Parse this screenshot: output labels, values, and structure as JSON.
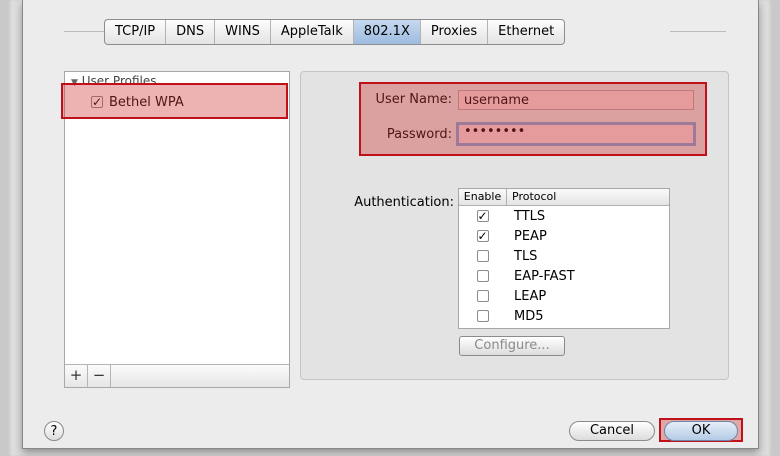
{
  "tabs": [
    "TCP/IP",
    "DNS",
    "WINS",
    "AppleTalk",
    "802.1X",
    "Proxies",
    "Ethernet"
  ],
  "selected_tab": "802.1X",
  "profiles": {
    "header": "User Profiles",
    "items": [
      {
        "label": "Bethel WPA",
        "checked": true
      }
    ]
  },
  "credentials": {
    "username_label": "User Name:",
    "username_value": "username",
    "password_label": "Password:",
    "password_value": "••••••••"
  },
  "auth": {
    "label": "Authentication:",
    "col_enable": "Enable",
    "col_protocol": "Protocol",
    "protocols": [
      {
        "name": "TTLS",
        "enabled": true
      },
      {
        "name": "PEAP",
        "enabled": true
      },
      {
        "name": "TLS",
        "enabled": false
      },
      {
        "name": "EAP-FAST",
        "enabled": false
      },
      {
        "name": "LEAP",
        "enabled": false
      },
      {
        "name": "MD5",
        "enabled": false
      }
    ],
    "configure_label": "Configure..."
  },
  "buttons": {
    "add": "+",
    "remove": "−",
    "help": "?",
    "cancel": "Cancel",
    "ok": "OK"
  },
  "colors": {
    "highlight": "#c0101a",
    "selected_tab": "#9dbbe0"
  }
}
